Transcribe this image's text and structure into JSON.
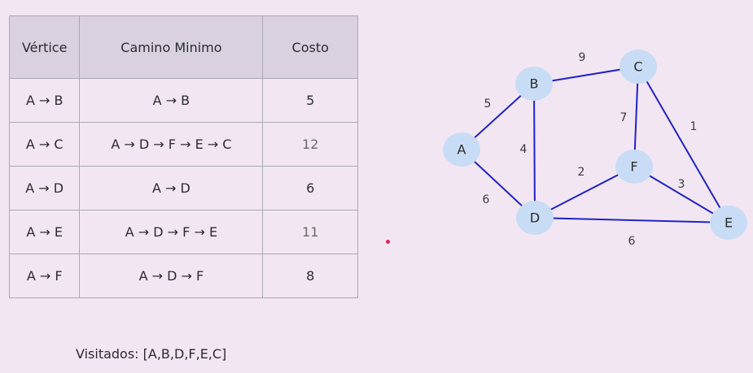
{
  "table": {
    "headers": [
      "Vértice",
      "Camino Minimo",
      "Costo"
    ],
    "rows": [
      {
        "vertex": "A → B",
        "path": "A → B",
        "cost": "5"
      },
      {
        "vertex": "A → C",
        "path": "A → D → F → E → C",
        "cost": "12"
      },
      {
        "vertex": "A → D",
        "path": "A → D",
        "cost": "6"
      },
      {
        "vertex": "A → E",
        "path": "A → D → F → E",
        "cost": "11"
      },
      {
        "vertex": "A → F",
        "path": "A → D → F",
        "cost": "8"
      }
    ]
  },
  "visited": "Visitados: [A,B,D,F,E,C]",
  "graph": {
    "nodes": [
      "A",
      "B",
      "C",
      "D",
      "E",
      "F"
    ],
    "edges": [
      {
        "from": "A",
        "to": "B",
        "weight": "5"
      },
      {
        "from": "A",
        "to": "D",
        "weight": "6"
      },
      {
        "from": "B",
        "to": "C",
        "weight": "9"
      },
      {
        "from": "B",
        "to": "D",
        "weight": "4"
      },
      {
        "from": "C",
        "to": "F",
        "weight": "7"
      },
      {
        "from": "C",
        "to": "E",
        "weight": "1"
      },
      {
        "from": "D",
        "to": "F",
        "weight": "2"
      },
      {
        "from": "F",
        "to": "E",
        "weight": "3"
      },
      {
        "from": "D",
        "to": "E",
        "weight": "6"
      }
    ]
  },
  "colors": {
    "background": "#f3e6f3",
    "header_fill": "#d9d0e0",
    "node_fill": "#c8dcf5",
    "edge_stroke": "#1f23c8",
    "pointer": "#e0245a"
  }
}
